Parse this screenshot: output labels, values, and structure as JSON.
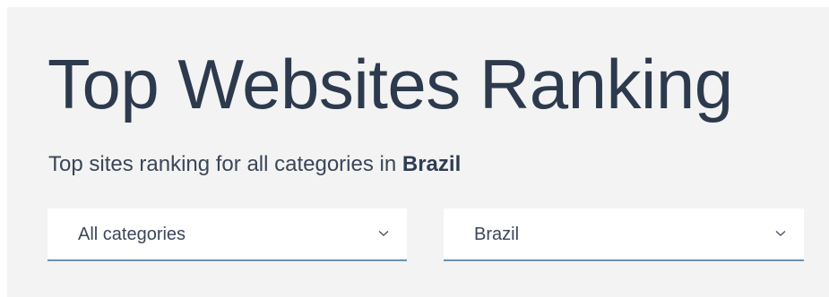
{
  "header": {
    "title": "Top Websites Ranking",
    "subtitle_prefix": "Top sites ranking for all categories in",
    "subtitle_country": "Brazil"
  },
  "filters": {
    "category": {
      "selected": "All categories",
      "icon": "chevron-down-icon"
    },
    "country": {
      "selected": "Brazil",
      "icon": "chevron-down-icon"
    }
  },
  "colors": {
    "panel_background": "#f3f3f3",
    "text": "#2f3d52",
    "select_underline": "#6b92ad"
  }
}
